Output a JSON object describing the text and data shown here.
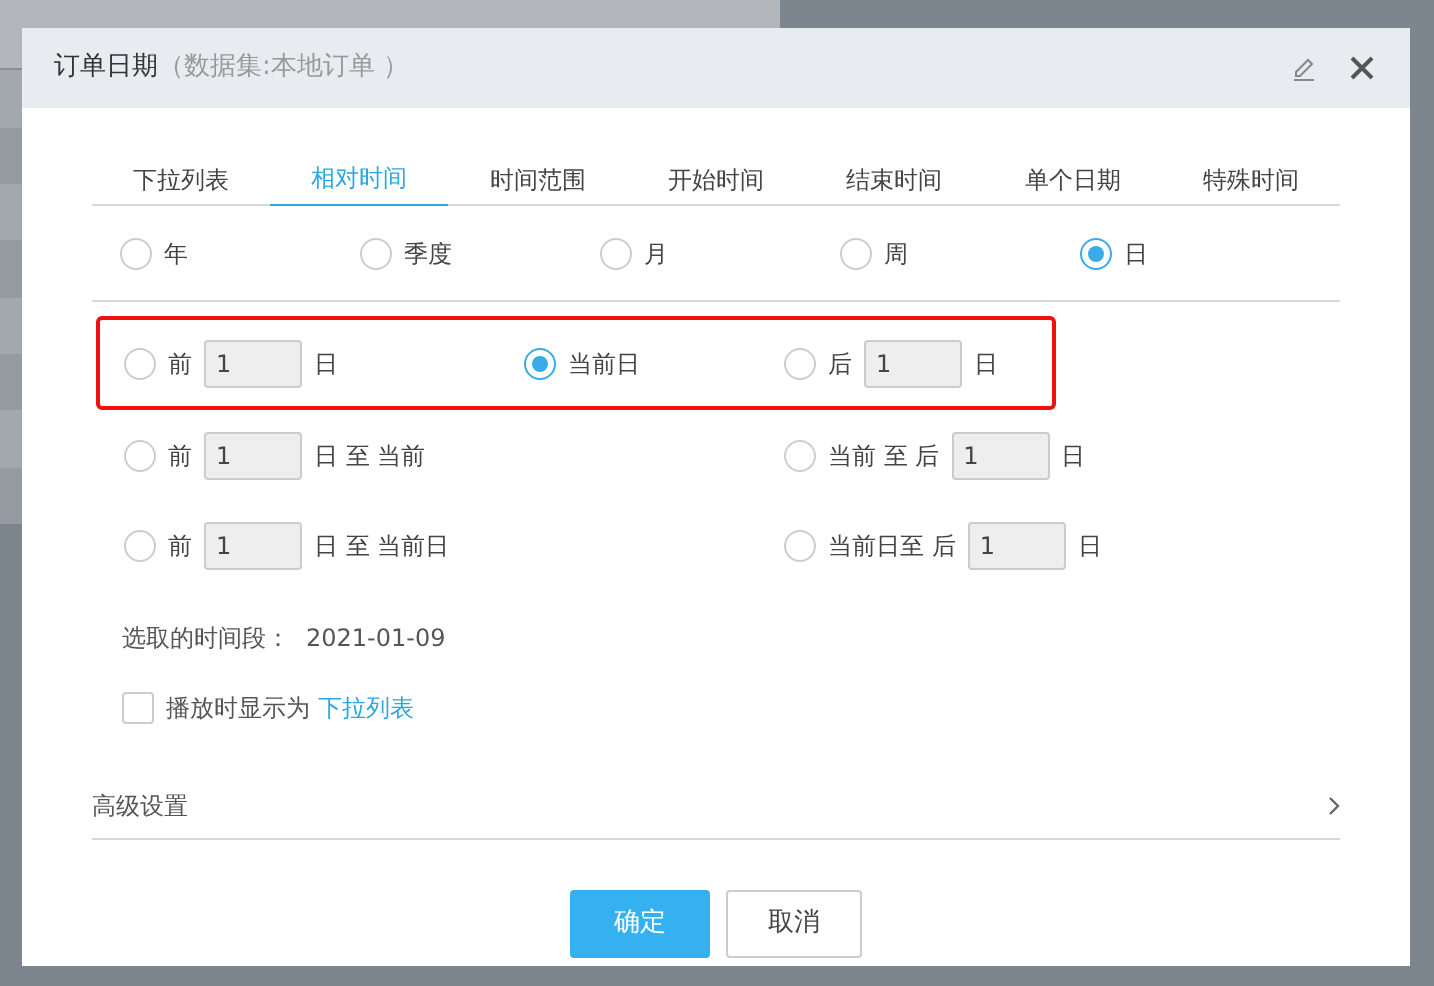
{
  "dialog": {
    "title": "订单日期",
    "subtitle": "（数据集:本地订单 ）"
  },
  "tabs": [
    {
      "label": "下拉列表",
      "selected": false
    },
    {
      "label": "相对时间",
      "selected": true
    },
    {
      "label": "时间范围",
      "selected": false
    },
    {
      "label": "开始时间",
      "selected": false
    },
    {
      "label": "结束时间",
      "selected": false
    },
    {
      "label": "单个日期",
      "selected": false
    },
    {
      "label": "特殊时间",
      "selected": false
    }
  ],
  "units": [
    {
      "label": "年",
      "selected": false
    },
    {
      "label": "季度",
      "selected": false
    },
    {
      "label": "月",
      "selected": false
    },
    {
      "label": "周",
      "selected": false
    },
    {
      "label": "日",
      "selected": true
    }
  ],
  "option_rows": [
    {
      "highlighted": true,
      "options": [
        {
          "selected": false,
          "segments": [
            {
              "kind": "text",
              "text": "前"
            },
            {
              "kind": "input",
              "value": "1"
            },
            {
              "kind": "text",
              "text": "日"
            }
          ]
        },
        {
          "selected": true,
          "segments": [
            {
              "kind": "text",
              "text": "当前日"
            }
          ]
        },
        {
          "selected": false,
          "segments": [
            {
              "kind": "text",
              "text": "后"
            },
            {
              "kind": "input",
              "value": "1"
            },
            {
              "kind": "text",
              "text": "日"
            }
          ]
        }
      ]
    },
    {
      "highlighted": false,
      "options": [
        {
          "selected": false,
          "segments": [
            {
              "kind": "text",
              "text": "前"
            },
            {
              "kind": "input",
              "value": "1"
            },
            {
              "kind": "text",
              "text": "日 至 当前"
            }
          ]
        },
        {
          "selected": false,
          "segments": [
            {
              "kind": "text",
              "text": "当前 至 后"
            },
            {
              "kind": "input",
              "value": "1"
            },
            {
              "kind": "text",
              "text": "日"
            }
          ]
        }
      ]
    },
    {
      "highlighted": false,
      "options": [
        {
          "selected": false,
          "segments": [
            {
              "kind": "text",
              "text": "前"
            },
            {
              "kind": "input",
              "value": "1"
            },
            {
              "kind": "text",
              "text": "日 至 当前日"
            }
          ]
        },
        {
          "selected": false,
          "segments": [
            {
              "kind": "text",
              "text": "当前日至 后"
            },
            {
              "kind": "input",
              "value": "1"
            },
            {
              "kind": "text",
              "text": "日"
            }
          ]
        }
      ]
    }
  ],
  "selected_period": {
    "label": "选取的时间段：",
    "value": "2021-01-09"
  },
  "display_option": {
    "checked": false,
    "label": "播放时显示为",
    "link": "下拉列表"
  },
  "advanced": {
    "label": "高级设置"
  },
  "buttons": [
    {
      "label": "确定",
      "kind": "primary"
    },
    {
      "label": "取消",
      "kind": "secondary"
    }
  ]
}
